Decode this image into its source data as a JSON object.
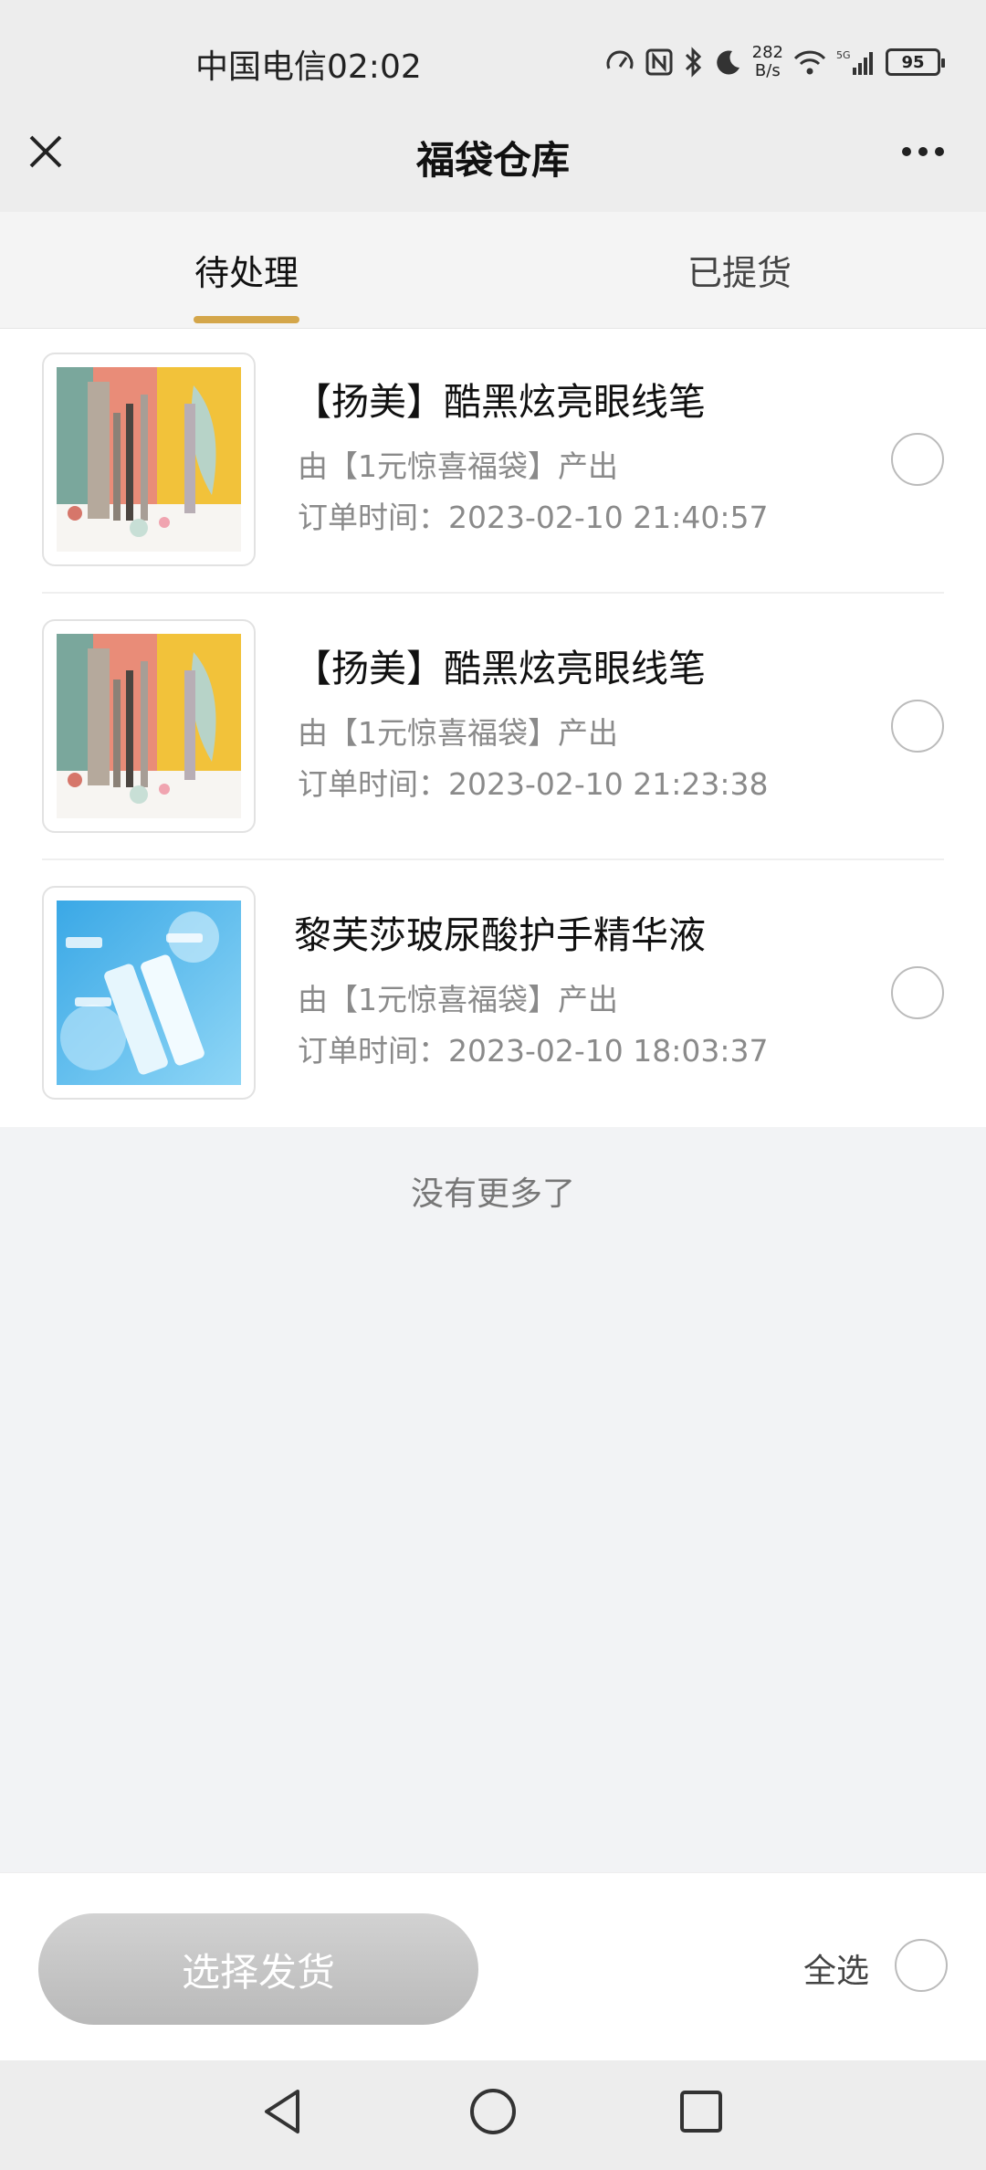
{
  "status_bar": {
    "carrier_time": "中国电信02:02",
    "net_speed_value": "282",
    "net_speed_unit": "B/s",
    "battery": "95"
  },
  "nav": {
    "title": "福袋仓库"
  },
  "tabs": [
    {
      "label": "待处理",
      "active": true
    },
    {
      "label": "已提货",
      "active": false
    }
  ],
  "items": [
    {
      "title": "【扬美】酷黑炫亮眼线笔",
      "source": "由【1元惊喜福袋】产出",
      "order_time": "订单时间：2023-02-10 21:40:57",
      "image": "eyeliner-product-image"
    },
    {
      "title": "【扬美】酷黑炫亮眼线笔",
      "source": "由【1元惊喜福袋】产出",
      "order_time": "订单时间：2023-02-10 21:23:38",
      "image": "eyeliner-product-image"
    },
    {
      "title": "黎芙莎玻尿酸护手精华液",
      "source": "由【1元惊喜福袋】产出",
      "order_time": "订单时间：2023-02-10 18:03:37",
      "image": "hand-essence-product-image"
    }
  ],
  "no_more_text": "没有更多了",
  "bottom": {
    "ship_button": "选择发货",
    "select_all": "全选"
  },
  "colors": {
    "accent_underline": "#d4a64a",
    "button_disabled": "#c4c4c4"
  }
}
